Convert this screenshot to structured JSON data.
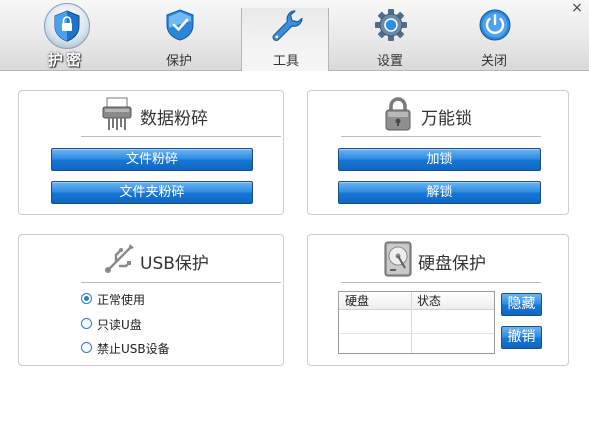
{
  "header": {
    "logo_label": "护密",
    "tabs": [
      {
        "label": "保护",
        "icon": "shield-icon"
      },
      {
        "label": "工具",
        "icon": "wrench-icon"
      },
      {
        "label": "设置",
        "icon": "gear-icon"
      },
      {
        "label": "关闭",
        "icon": "power-icon"
      }
    ],
    "active_tab": "工具",
    "close_glyph": "×"
  },
  "shred_panel": {
    "title": "数据粉碎",
    "icon": "shredder-icon",
    "buttons": [
      "文件粉碎",
      "文件夹粉碎"
    ]
  },
  "lock_panel": {
    "title": "万能锁",
    "icon": "padlock-icon",
    "buttons": [
      "加锁",
      "解锁"
    ]
  },
  "usb_panel": {
    "title": "USB保护",
    "icon": "usb-icon",
    "options": [
      {
        "label": "正常使用",
        "selected": true
      },
      {
        "label": "只读U盘",
        "selected": false
      },
      {
        "label": "禁止USB设备",
        "selected": false
      }
    ]
  },
  "disk_panel": {
    "title": "硬盘保护",
    "icon": "hard-disk-icon",
    "columns": [
      "硬盘",
      "状态"
    ],
    "rows": [],
    "buttons": [
      "隐藏",
      "撤销"
    ]
  },
  "colors": {
    "accent_blue": "#1677d6",
    "button_border": "#1b4f86",
    "panel_border": "#cfcfcf"
  }
}
